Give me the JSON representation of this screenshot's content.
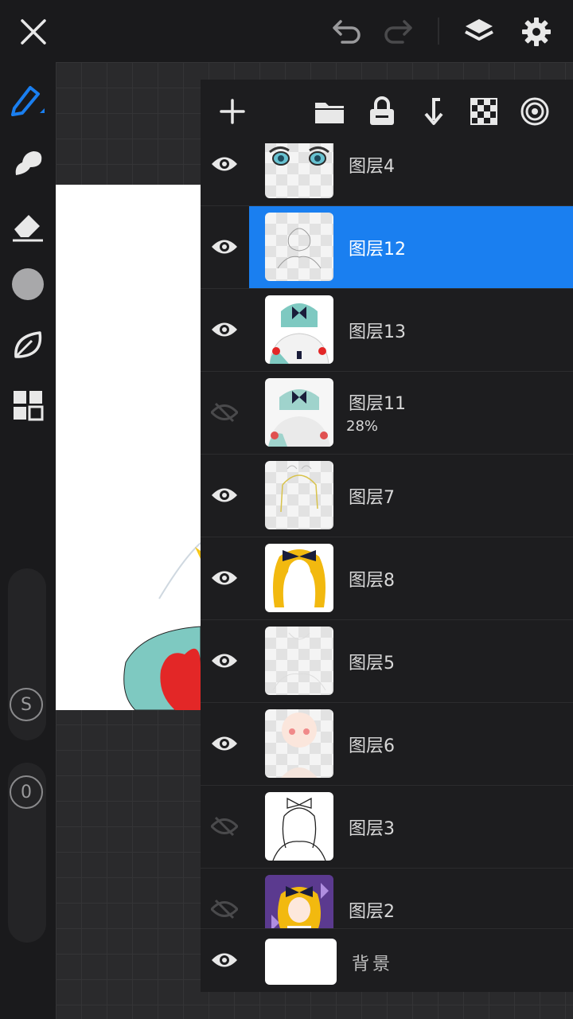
{
  "colors": {
    "accent": "#1a7ff0",
    "panel": "#1d1d1f",
    "toolbar": "#1a1a1c"
  },
  "toolbar": {
    "close_icon": "close-icon",
    "undo_icon": "undo-icon",
    "redo_icon": "redo-icon",
    "layers_icon": "layers-icon",
    "settings_icon": "gear-icon"
  },
  "left_tools": {
    "items": [
      "pen-tool",
      "smudge-tool",
      "eraser-tool",
      "color-swatch",
      "leaf-tool",
      "grid-tool"
    ],
    "size_label": "S",
    "opacity_label": "0"
  },
  "layers": {
    "items": [
      {
        "name": "图层4",
        "visible": true
      },
      {
        "name": "图层12",
        "visible": true,
        "selected": true
      },
      {
        "name": "图层13",
        "visible": true
      },
      {
        "name": "图层11",
        "visible": false,
        "opacity": "28%"
      },
      {
        "name": "图层7",
        "visible": true
      },
      {
        "name": "图层8",
        "visible": true
      },
      {
        "name": "图层5",
        "visible": true
      },
      {
        "name": "图层6",
        "visible": true
      },
      {
        "name": "图层3",
        "visible": false
      },
      {
        "name": "图层2",
        "visible": false
      }
    ],
    "background": {
      "name": "背景",
      "visible": true
    }
  }
}
